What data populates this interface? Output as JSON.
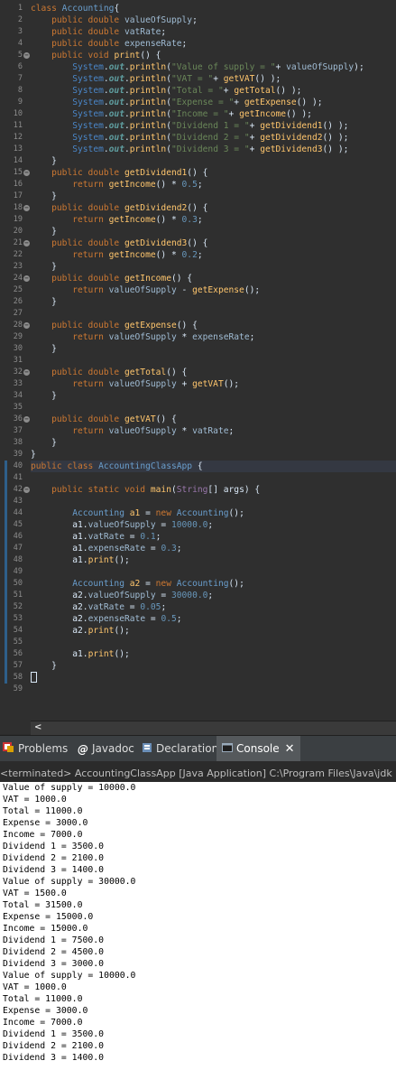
{
  "editor": {
    "line_numbers": [
      "1",
      "2",
      "3",
      "4",
      "5",
      "6",
      "7",
      "8",
      "9",
      "10",
      "11",
      "12",
      "13",
      "14",
      "15",
      "16",
      "17",
      "18",
      "19",
      "20",
      "21",
      "22",
      "23",
      "24",
      "25",
      "26",
      "27",
      "28",
      "29",
      "30",
      "31",
      "32",
      "33",
      "34",
      "35",
      "36",
      "37",
      "38",
      "39",
      "40",
      "41",
      "42",
      "43",
      "44",
      "45",
      "46",
      "47",
      "48",
      "49",
      "50",
      "51",
      "52",
      "53",
      "54",
      "55",
      "56",
      "57",
      "58",
      "59"
    ],
    "folded_lines": [
      5,
      15,
      18,
      21,
      24,
      28,
      32,
      36,
      42
    ],
    "marked_lines": [
      40,
      41,
      42,
      43,
      44,
      45,
      46,
      47,
      48,
      49,
      50,
      51,
      52,
      53,
      54,
      55,
      56,
      57,
      58
    ],
    "highlighted_line": 40,
    "code_lines": [
      "class Accounting{",
      "    public double valueOfSupply;",
      "    public double vatRate;",
      "    public double expenseRate;",
      "    public void print() {",
      "        System.out.println(\"Value of supply = \"+ valueOfSupply);",
      "        System.out.println(\"VAT = \"+ getVAT() );",
      "        System.out.println(\"Total = \"+ getTotal() );",
      "        System.out.println(\"Expense = \"+ getExpense() );",
      "        System.out.println(\"Income = \"+ getIncome() );",
      "        System.out.println(\"Dividend 1 = \"+ getDividend1() );",
      "        System.out.println(\"Dividend 2 = \"+ getDividend2() );",
      "        System.out.println(\"Dividend 3 = \"+ getDividend3() );",
      "    }",
      "    public double getDividend1() {",
      "        return getIncome() * 0.5;",
      "    }",
      "    public double getDividend2() {",
      "        return getIncome() * 0.3;",
      "    }",
      "    public double getDividend3() {",
      "        return getIncome() * 0.2;",
      "    }",
      "    public double getIncome() {",
      "        return valueOfSupply - getExpense();",
      "    }",
      "",
      "    public double getExpense() {",
      "        return valueOfSupply * expenseRate;",
      "    }",
      "",
      "    public double getTotal() {",
      "        return valueOfSupply + getVAT();",
      "    }",
      "",
      "    public double getVAT() {",
      "        return valueOfSupply * vatRate;",
      "    }",
      "}",
      "public class AccountingClassApp {",
      "",
      "    public static void main(String[] args) {",
      "",
      "        Accounting a1 = new Accounting();",
      "        a1.valueOfSupply = 10000.0;",
      "        a1.vatRate = 0.1;",
      "        a1.expenseRate = 0.3;",
      "        a1.print();",
      "",
      "        Accounting a2 = new Accounting();",
      "        a2.valueOfSupply = 30000.0;",
      "        a2.vatRate = 0.05;",
      "        a2.expenseRate = 0.5;",
      "        a2.print();",
      "",
      "        a1.print();",
      "    }",
      "}",
      ""
    ],
    "scroll_left_label": "<"
  },
  "tabs": [
    {
      "label": "Problems",
      "icon": "problems-icon",
      "active": false
    },
    {
      "label": "Javadoc",
      "icon": "at-sign-icon",
      "active": false
    },
    {
      "label": "Declaration",
      "icon": "declaration-icon",
      "active": false
    },
    {
      "label": "Console",
      "icon": "console-icon",
      "active": true
    }
  ],
  "console_close_label": "✕",
  "console": {
    "header": "<terminated> AccountingClassApp [Java Application] C:\\Program Files\\Java\\jdk",
    "output": [
      "Value of supply = 10000.0",
      "VAT = 1000.0",
      "Total = 11000.0",
      "Expense = 3000.0",
      "Income = 7000.0",
      "Dividend 1 = 3500.0",
      "Dividend 2 = 2100.0",
      "Dividend 3 = 1400.0",
      "Value of supply = 30000.0",
      "VAT = 1500.0",
      "Total = 31500.0",
      "Expense = 15000.0",
      "Income = 15000.0",
      "Dividend 1 = 7500.0",
      "Dividend 2 = 4500.0",
      "Dividend 3 = 3000.0",
      "Value of supply = 10000.0",
      "VAT = 1000.0",
      "Total = 11000.0",
      "Expense = 3000.0",
      "Income = 7000.0",
      "Dividend 1 = 3500.0",
      "Dividend 2 = 2100.0",
      "Dividend 3 = 1400.0"
    ]
  },
  "colors": {
    "editor_bg": "#2f2f2f",
    "keyword": "#cc7832",
    "method": "#ffc66d",
    "string": "#6a8759",
    "number": "#6897bb",
    "console_bg": "#ffffff"
  }
}
